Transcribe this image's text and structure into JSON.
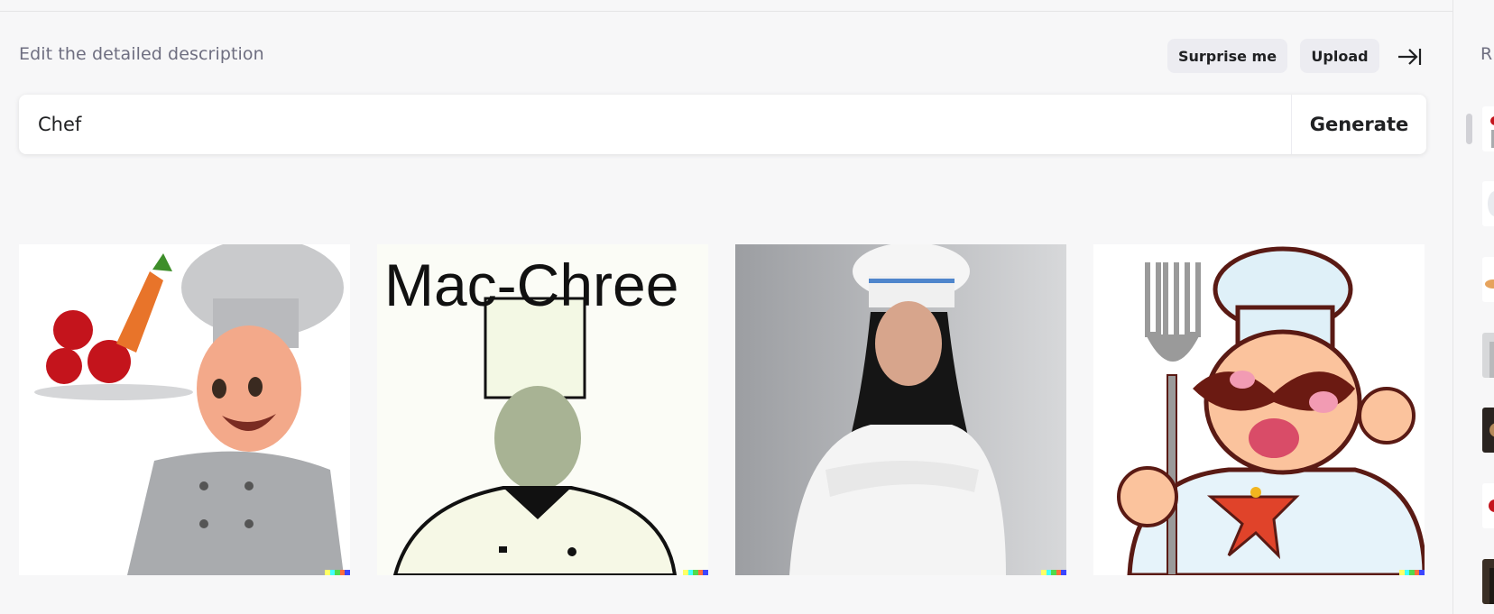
{
  "editor": {
    "label": "Edit the detailed description",
    "surprise_label": "Surprise me",
    "upload_label": "Upload",
    "prompt_value": "Chef",
    "generate_label": "Generate"
  },
  "results": [
    {
      "id": "result-1",
      "alt": "3D cartoon chef holding plate"
    },
    {
      "id": "result-2",
      "alt": "Chef sketch",
      "caption": "Mac-Chree"
    },
    {
      "id": "result-3",
      "alt": "Smiling chef with arms crossed"
    },
    {
      "id": "result-4",
      "alt": "Cartoon chef with fork"
    }
  ],
  "history": {
    "label": "R"
  },
  "colors": {
    "background": "#f7f7f8",
    "button_bg": "#ececf1",
    "muted_text": "#6e6e80",
    "badge": [
      "#ffff66",
      "#42ffff",
      "#51da4c",
      "#ff6e3c",
      "#3c46ff"
    ]
  }
}
